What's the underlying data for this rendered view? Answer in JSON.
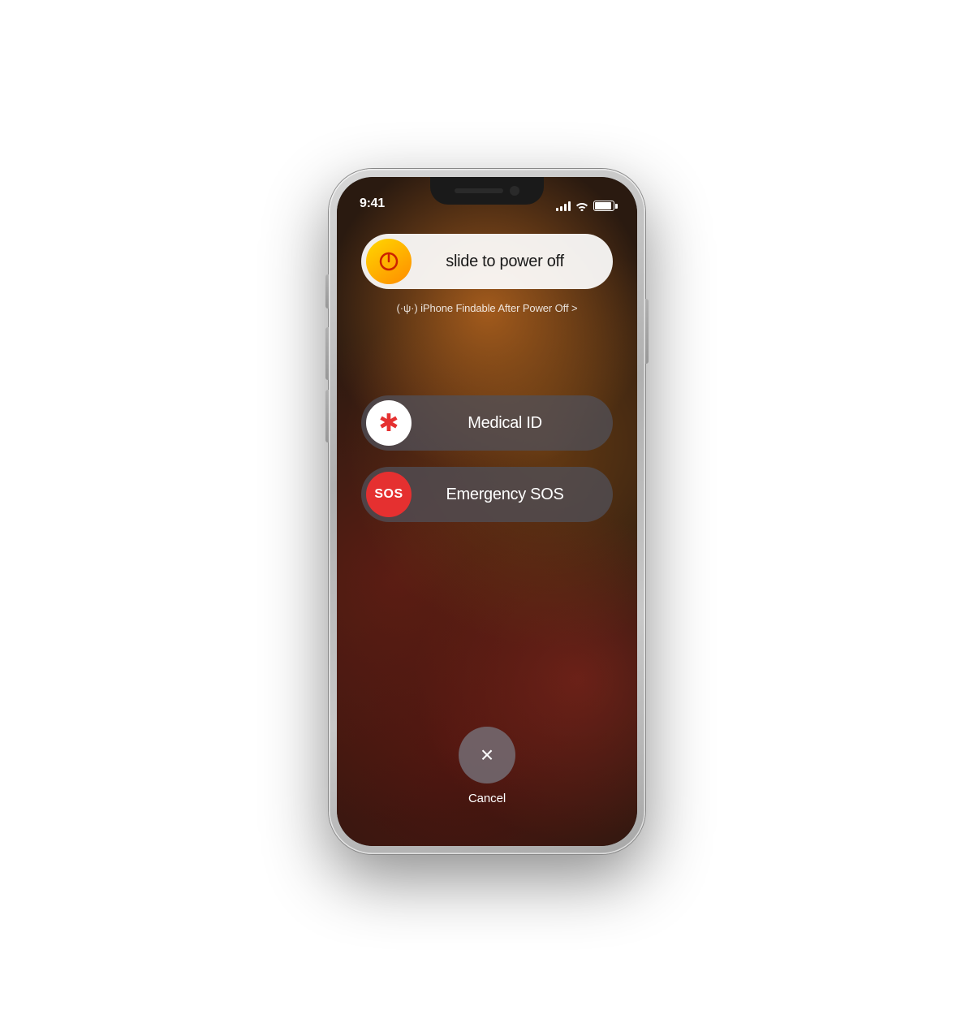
{
  "phone": {
    "status_bar": {
      "time": "9:41"
    },
    "power_slider": {
      "label": "slide to power off",
      "icon": "power"
    },
    "findable_text": "(·ψ·) iPhone Findable After Power Off >",
    "medical_slider": {
      "label": "Medical ID",
      "icon": "*"
    },
    "sos_slider": {
      "label": "Emergency SOS",
      "badge": "SOS"
    },
    "cancel_button": {
      "label": "Cancel",
      "icon": "×"
    }
  }
}
